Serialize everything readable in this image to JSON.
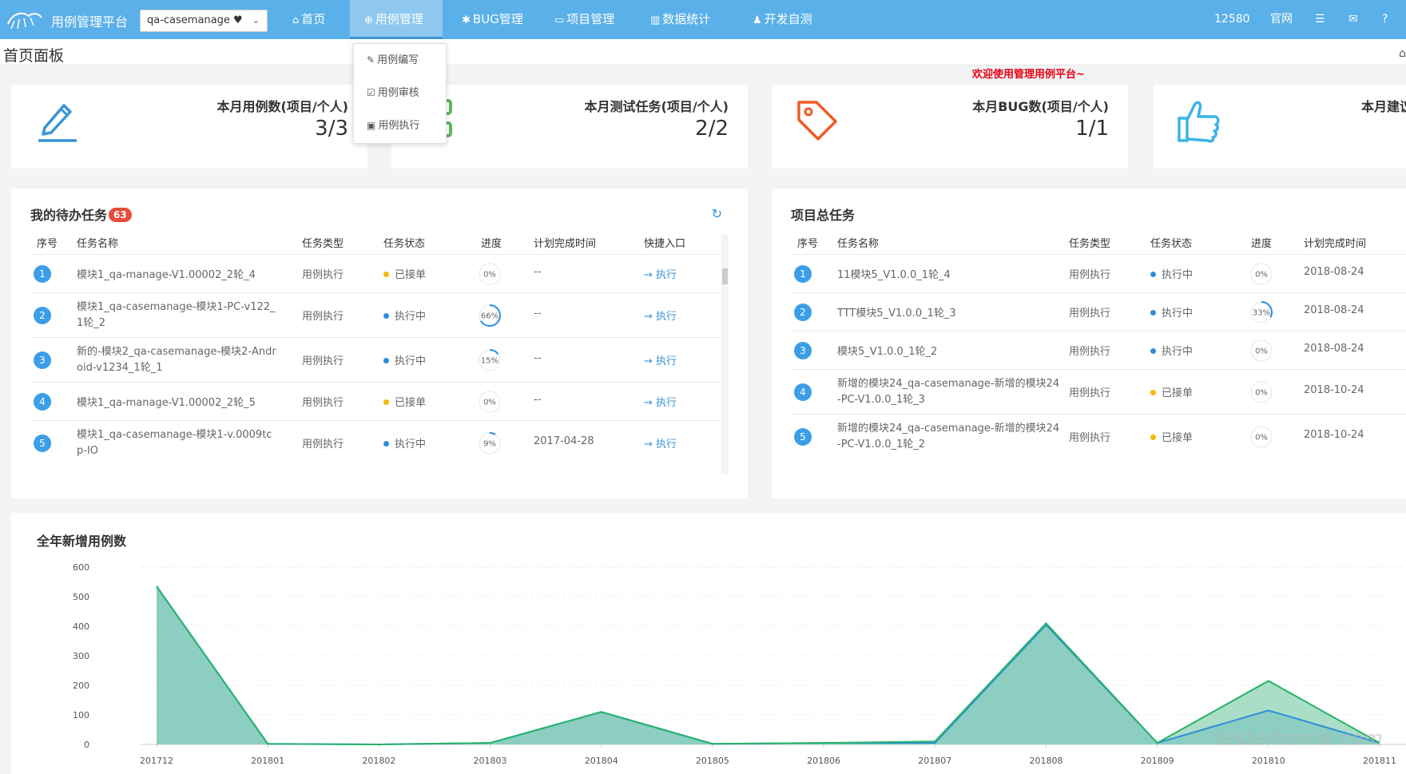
{
  "topbar": {
    "brand": "用例管理平台",
    "project_select": "qa-casemanage ♥",
    "nav": [
      {
        "label": "首页",
        "icon": "home-icon",
        "glyph": "⌂"
      },
      {
        "label": "用例管理",
        "icon": "cases-icon",
        "glyph": "⊕",
        "active": true
      },
      {
        "label": "BUG管理",
        "icon": "bug-icon",
        "glyph": "✱"
      },
      {
        "label": "项目管理",
        "icon": "folder-icon",
        "glyph": "▭"
      },
      {
        "label": "数据统计",
        "icon": "bar-chart-icon",
        "glyph": "▥"
      },
      {
        "label": "开发自测",
        "icon": "user-icon",
        "glyph": "♟"
      }
    ],
    "user_id": "12580",
    "site_link": "官网",
    "tool_icons": [
      "list-icon",
      "mail-icon",
      "help-icon"
    ]
  },
  "dropdown": {
    "items": [
      {
        "label": "用例编写",
        "icon": "edit-icon",
        "glyph": "✎"
      },
      {
        "label": "用例审核",
        "icon": "check-icon",
        "glyph": "☑"
      },
      {
        "label": "用例执行",
        "icon": "execute-icon",
        "glyph": "▣"
      }
    ]
  },
  "breadcrumb": {
    "title": "首页面板"
  },
  "welcome": "欢迎使用管理用例平台~",
  "cards": [
    {
      "label": "本月用例数(项目/个人)",
      "value": "3/3",
      "icon": "pencil-icon",
      "color": "#3b93d6"
    },
    {
      "label": "本月测试任务(项目/个人)",
      "value": "2/2",
      "icon": "task-icon",
      "color": "#5cb85c"
    },
    {
      "label": "本月BUG数(项目/个人)",
      "value": "1/1",
      "icon": "tag-icon",
      "color": "#f05a24"
    },
    {
      "label": "本月建议",
      "value": "",
      "icon": "thumbs-up-icon",
      "color": "#3bb4e8"
    }
  ],
  "todo": {
    "title": "我的待办任务",
    "badge": "63",
    "headers": [
      "序号",
      "任务名称",
      "任务类型",
      "任务状态",
      "进度",
      "计划完成时间",
      "快捷入口"
    ],
    "rows": [
      {
        "no": "1",
        "name": "模块1_qa-manage-V1.00002_2轮_4",
        "type": "用例执行",
        "status": "已接单",
        "status_color": "#f5b800",
        "progress": 0,
        "progress_label": "0%",
        "due": "--",
        "action": "→ 执行"
      },
      {
        "no": "2",
        "name": "模块1_qa-casemanage-模块1-PC-v122_1轮_2",
        "type": "用例执行",
        "status": "执行中",
        "status_color": "#2e8ddb",
        "progress": 66,
        "progress_label": "66%",
        "due": "--",
        "action": "→ 执行"
      },
      {
        "no": "3",
        "name": "新的-模块2_qa-casemanage-模块2-Android-v1234_1轮_1",
        "type": "用例执行",
        "status": "执行中",
        "status_color": "#2e8ddb",
        "progress": 15,
        "progress_label": "15%",
        "due": "--",
        "action": "→ 执行"
      },
      {
        "no": "4",
        "name": "模块1_qa-manage-V1.00002_2轮_5",
        "type": "用例执行",
        "status": "已接单",
        "status_color": "#f5b800",
        "progress": 0,
        "progress_label": "0%",
        "due": "--",
        "action": "→ 执行"
      },
      {
        "no": "5",
        "name": "模块1_qa-casemanage-模块1-v.0009tcp-IO",
        "type": "用例执行",
        "status": "执行中",
        "status_color": "#2e8ddb",
        "progress": 9,
        "progress_label": "9%",
        "due": "2017-04-28",
        "action": "→ 执行"
      }
    ]
  },
  "project_tasks": {
    "title": "项目总任务",
    "headers": [
      "序号",
      "任务名称",
      "任务类型",
      "任务状态",
      "进度",
      "计划完成时间"
    ],
    "rows": [
      {
        "no": "1",
        "name": "11模块5_V1.0.0_1轮_4",
        "type": "用例执行",
        "status": "执行中",
        "status_color": "#2e8ddb",
        "progress": 0,
        "progress_label": "0%",
        "due": "2018-08-24"
      },
      {
        "no": "2",
        "name": "TTT模块5_V1.0.0_1轮_3",
        "type": "用例执行",
        "status": "执行中",
        "status_color": "#2e8ddb",
        "progress": 33,
        "progress_label": "33%",
        "due": "2018-08-24"
      },
      {
        "no": "3",
        "name": "模块5_V1.0.0_1轮_2",
        "type": "用例执行",
        "status": "执行中",
        "status_color": "#2e8ddb",
        "progress": 0,
        "progress_label": "0%",
        "due": "2018-08-24"
      },
      {
        "no": "4",
        "name": "新增的模块24_qa-casemanage-新增的模块24-PC-V1.0.0_1轮_3",
        "type": "用例执行",
        "status": "已接单",
        "status_color": "#f5b800",
        "progress": 0,
        "progress_label": "0%",
        "due": "2018-10-24"
      },
      {
        "no": "5",
        "name": "新增的模块24_qa-casemanage-新增的模块24-PC-V1.0.0_1轮_2",
        "type": "用例执行",
        "status": "已接单",
        "status_color": "#f5b800",
        "progress": 0,
        "progress_label": "0%",
        "due": "2018-10-24"
      }
    ]
  },
  "chart_title": "全年新增用例数",
  "chart_data": {
    "type": "area",
    "title": "全年新增用例数",
    "categories": [
      "201712",
      "201801",
      "201802",
      "201803",
      "201804",
      "201805",
      "201806",
      "201807",
      "201808",
      "201809",
      "201810",
      "201811"
    ],
    "yticks": [
      0,
      100,
      200,
      300,
      400,
      500,
      600
    ],
    "ylim": [
      0,
      600
    ],
    "grid": true,
    "series": [
      {
        "color": "#27b36a",
        "fill": "#8fd3b4",
        "values": [
          535,
          2,
          0,
          5,
          110,
          2,
          5,
          10,
          410,
          5,
          215,
          5
        ]
      },
      {
        "color": "#2e8ddb",
        "fill": "#86cbc0",
        "values": [
          535,
          2,
          0,
          5,
          110,
          2,
          5,
          5,
          405,
          5,
          115,
          5
        ]
      }
    ]
  },
  "watermark": "testerhome.com"
}
